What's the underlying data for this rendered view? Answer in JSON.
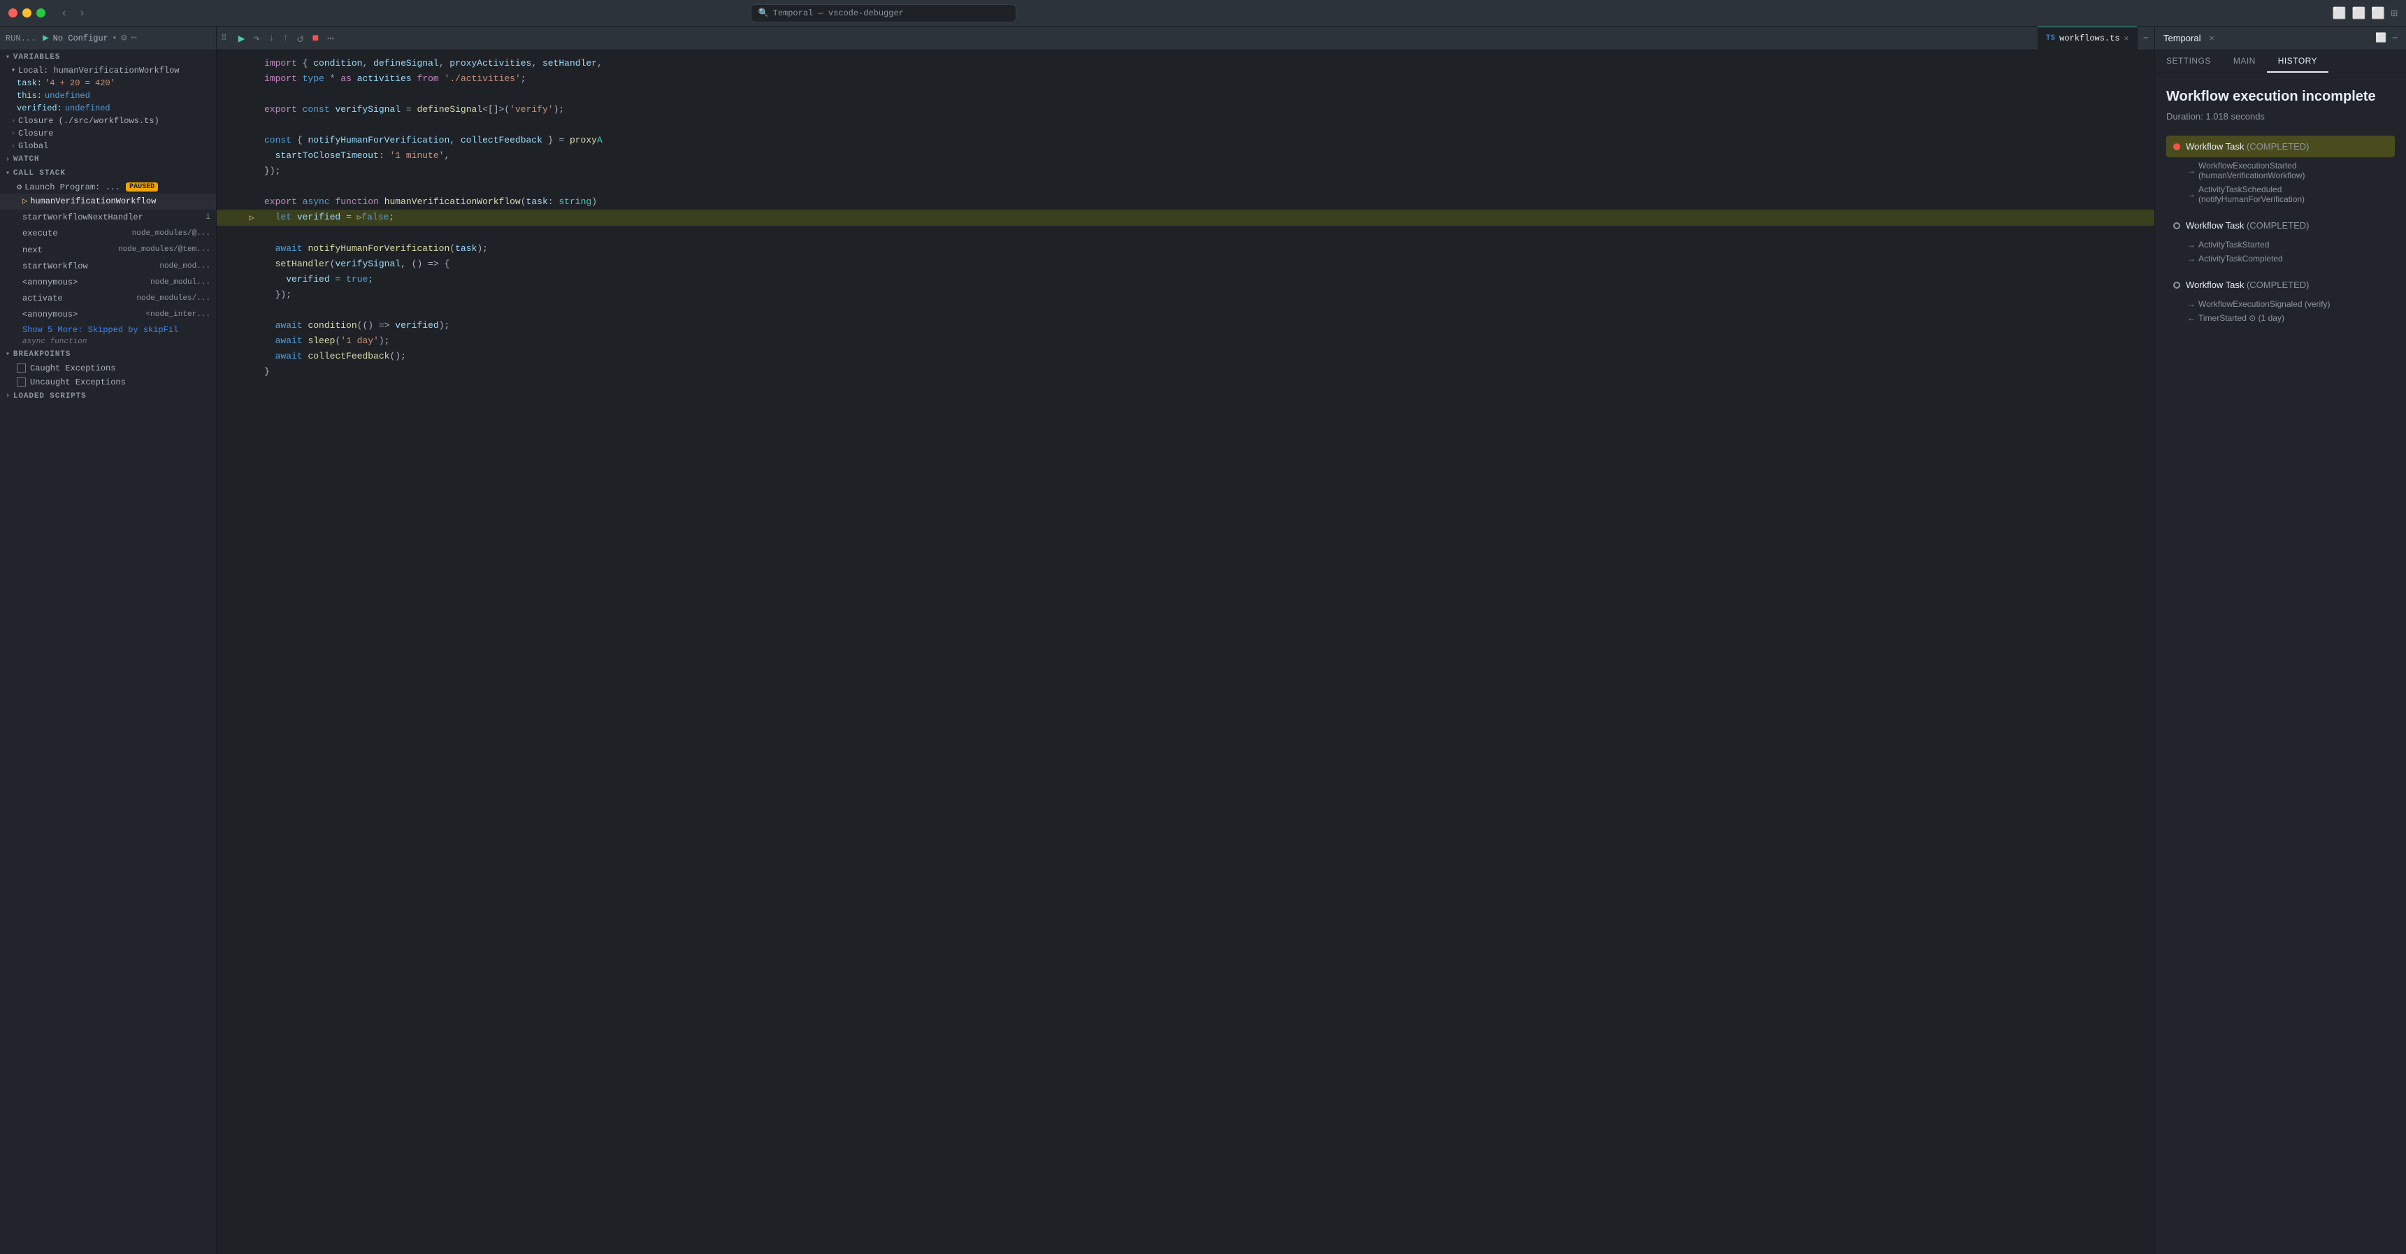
{
  "titlebar": {
    "search_text": "Temporal — vscode-debugger",
    "nav_back": "‹",
    "nav_forward": "›"
  },
  "debug_toolbar": {
    "run_label": "RUN...",
    "config_name": "No Configur",
    "continue_icon": "▶",
    "step_over_icon": "↷",
    "step_into_icon": "↓",
    "step_out_icon": "↑",
    "restart_icon": "↺",
    "stop_icon": "■",
    "more_icon": "⋯"
  },
  "tab": {
    "filename": "workflows.ts",
    "type_icon": "TS"
  },
  "variables": {
    "section_label": "VARIABLES",
    "local_label": "Local: humanVerificationWorkflow",
    "items": [
      {
        "key": "task:",
        "value": "'4 + 20 = 420'"
      },
      {
        "key": "this:",
        "value": "undefined"
      },
      {
        "key": "verified:",
        "value": "undefined"
      }
    ],
    "groups": [
      "Closure (./src/workflows.ts)",
      "Closure",
      "Global"
    ]
  },
  "watch": {
    "section_label": "WATCH"
  },
  "callstack": {
    "section_label": "CALL STACK",
    "launch_label": "Launch Program: ...",
    "paused_badge": "PAUSED",
    "frames": [
      {
        "name": "humanVerificationWorkflow",
        "ref": ""
      },
      {
        "name": "startWorkflowNextHandler",
        "ref": "i"
      },
      {
        "name": "execute",
        "ref": "node_modules/@..."
      },
      {
        "name": "next",
        "ref": "node_modules/@tem..."
      },
      {
        "name": "startWorkflow",
        "ref": "node_mod..."
      },
      {
        "name": "<anonymous>",
        "ref": "node_modul..."
      },
      {
        "name": "activate",
        "ref": "node_modules/..."
      },
      {
        "name": "<anonymous>",
        "ref": "<node_inter..."
      }
    ],
    "show_more": "Show 5 More: Skipped by skipFil",
    "async_label": "async function"
  },
  "breakpoints": {
    "section_label": "BREAKPOINTS",
    "items": [
      {
        "label": "Caught Exceptions",
        "checked": false
      },
      {
        "label": "Uncaught Exceptions",
        "checked": false
      }
    ]
  },
  "loaded_scripts": {
    "section_label": "LOADED SCRIPTS"
  },
  "code": {
    "lines": [
      {
        "num": "",
        "content": "import { condition, defineSignal, proxyActivities, setHandler,",
        "highlight": false
      },
      {
        "num": "",
        "content": "import type * as activities from './activities';",
        "highlight": false
      },
      {
        "num": "",
        "content": "",
        "highlight": false
      },
      {
        "num": "",
        "content": "export const verifySignal = defineSignal<[]>('verify');",
        "highlight": false
      },
      {
        "num": "",
        "content": "",
        "highlight": false
      },
      {
        "num": "",
        "content": "const { notifyHumanForVerification, collectFeedback } = proxy",
        "highlight": false
      },
      {
        "num": "",
        "content": "  startToCloseTimeout: '1 minute',",
        "highlight": false
      },
      {
        "num": "",
        "content": "});",
        "highlight": false
      },
      {
        "num": "",
        "content": "",
        "highlight": false
      },
      {
        "num": "",
        "content": "export async function humanVerificationWorkflow(task: string)",
        "highlight": false
      },
      {
        "num": "",
        "content": "  let verified = false;",
        "highlight": true,
        "arrow": true
      },
      {
        "num": "",
        "content": "",
        "highlight": false
      },
      {
        "num": "",
        "content": "  await notifyHumanForVerification(task);",
        "highlight": false
      },
      {
        "num": "",
        "content": "  setHandler(verifySignal, () => {",
        "highlight": false
      },
      {
        "num": "",
        "content": "    verified = true;",
        "highlight": false
      },
      {
        "num": "",
        "content": "  });",
        "highlight": false
      },
      {
        "num": "",
        "content": "",
        "highlight": false
      },
      {
        "num": "",
        "content": "  await condition(() => verified);",
        "highlight": false
      },
      {
        "num": "",
        "content": "  await sleep('1 day');",
        "highlight": false
      },
      {
        "num": "",
        "content": "  await collectFeedback();",
        "highlight": false
      },
      {
        "num": "",
        "content": "}",
        "highlight": false
      }
    ]
  },
  "right_panel": {
    "title": "Temporal",
    "tabs": [
      "SETTINGS",
      "MAIN",
      "HISTORY"
    ],
    "active_tab": "HISTORY",
    "workflow_title": "Workflow execution incomplete",
    "duration": "Duration: 1.018 seconds",
    "history": [
      {
        "type": "task",
        "dot": "red",
        "label": "Workflow Task",
        "status": "(COMPLETED)",
        "highlight": true,
        "sub_events": [
          {
            "arrow": "→",
            "text": "WorkflowExecutionStarted (humanVerificationWorkflow)"
          },
          {
            "arrow": "→",
            "text": "ActivityTaskScheduled (notifyHumanForVerification)"
          }
        ]
      },
      {
        "type": "task",
        "dot": "outline",
        "label": "Workflow Task",
        "status": "(COMPLETED)",
        "highlight": false,
        "sub_events": [
          {
            "arrow": "→",
            "text": "ActivityTaskStarted"
          },
          {
            "arrow": "→",
            "text": "ActivityTaskCompleted"
          }
        ]
      },
      {
        "type": "task",
        "dot": "outline",
        "label": "Workflow Task",
        "status": "(COMPLETED)",
        "highlight": false,
        "sub_events": [
          {
            "arrow": "→",
            "text": "WorkflowExecutionSignaled (verify)"
          },
          {
            "arrow": "←",
            "text": "TimerStarted ⊙ (1 day)"
          }
        ]
      }
    ]
  }
}
